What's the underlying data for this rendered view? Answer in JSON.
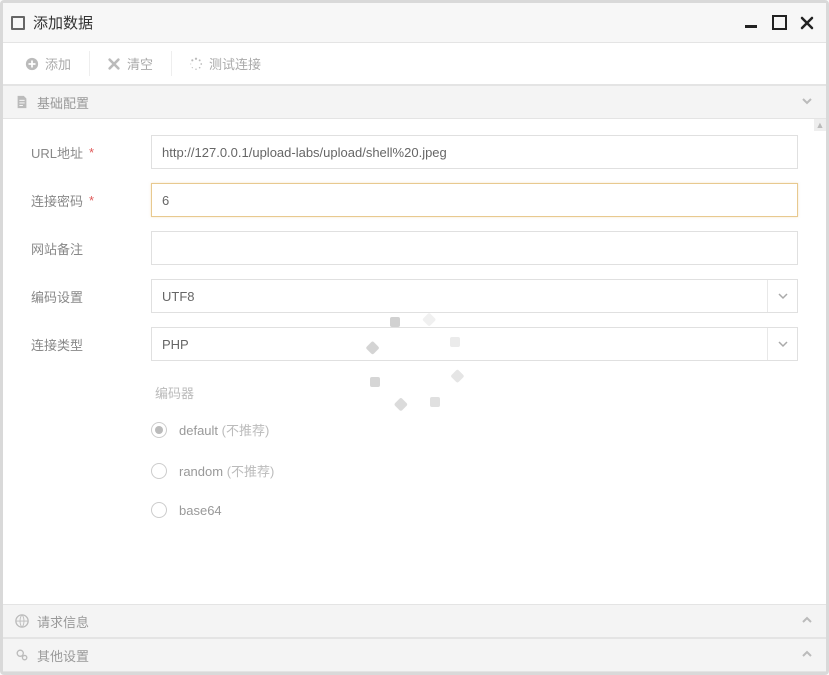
{
  "window": {
    "title": "添加数据"
  },
  "toolbar": {
    "add_label": "添加",
    "clear_label": "清空",
    "test_label": "测试连接"
  },
  "sections": {
    "basic": "基础配置",
    "request": "请求信息",
    "other": "其他设置"
  },
  "form": {
    "url_label": "URL地址",
    "url_value": "http://127.0.0.1/upload-labs/upload/shell%20.jpeg",
    "pwd_label": "连接密码",
    "pwd_value": "6",
    "note_label": "网站备注",
    "note_value": "",
    "encode_label": "编码设置",
    "encode_value": "UTF8",
    "type_label": "连接类型",
    "type_value": "PHP"
  },
  "encoder": {
    "title": "编码器",
    "options": [
      {
        "name": "default",
        "hint": "(不推荐)",
        "checked": true
      },
      {
        "name": "random",
        "hint": "(不推荐)",
        "checked": false
      },
      {
        "name": "base64",
        "hint": "",
        "checked": false
      }
    ]
  }
}
